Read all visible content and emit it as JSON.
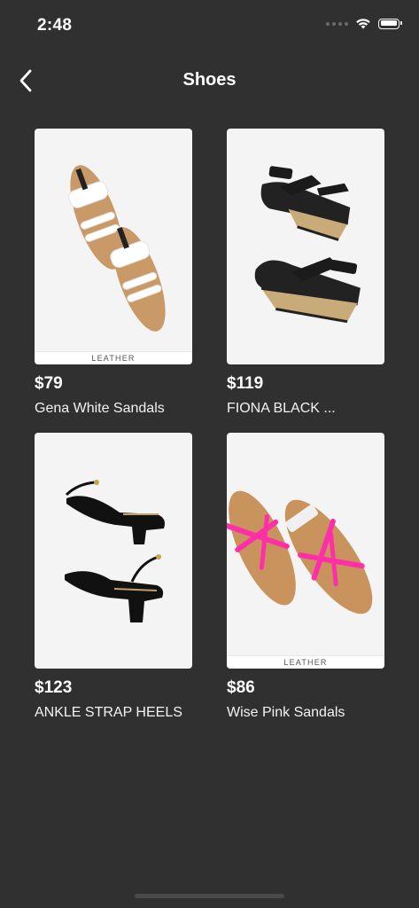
{
  "status_bar": {
    "time": "2:48"
  },
  "nav": {
    "back_icon": "chevron-left-icon",
    "title": "Shoes"
  },
  "products": [
    {
      "price": "$79",
      "name": "Gena White Sandals",
      "tag": "LEATHER",
      "image": "white-sandals"
    },
    {
      "price": "$119",
      "name": "FIONA BLACK ...",
      "tag": "",
      "image": "black-wedges"
    },
    {
      "price": "$123",
      "name": "ANKLE STRAP HEELS",
      "tag": "",
      "image": "black-heels"
    },
    {
      "price": "$86",
      "name": "Wise Pink Sandals",
      "tag": "LEATHER",
      "image": "pink-sandals"
    }
  ],
  "colors": {
    "background": "#303030",
    "text": "#ffffff",
    "image_bg": "#f4f4f4"
  }
}
